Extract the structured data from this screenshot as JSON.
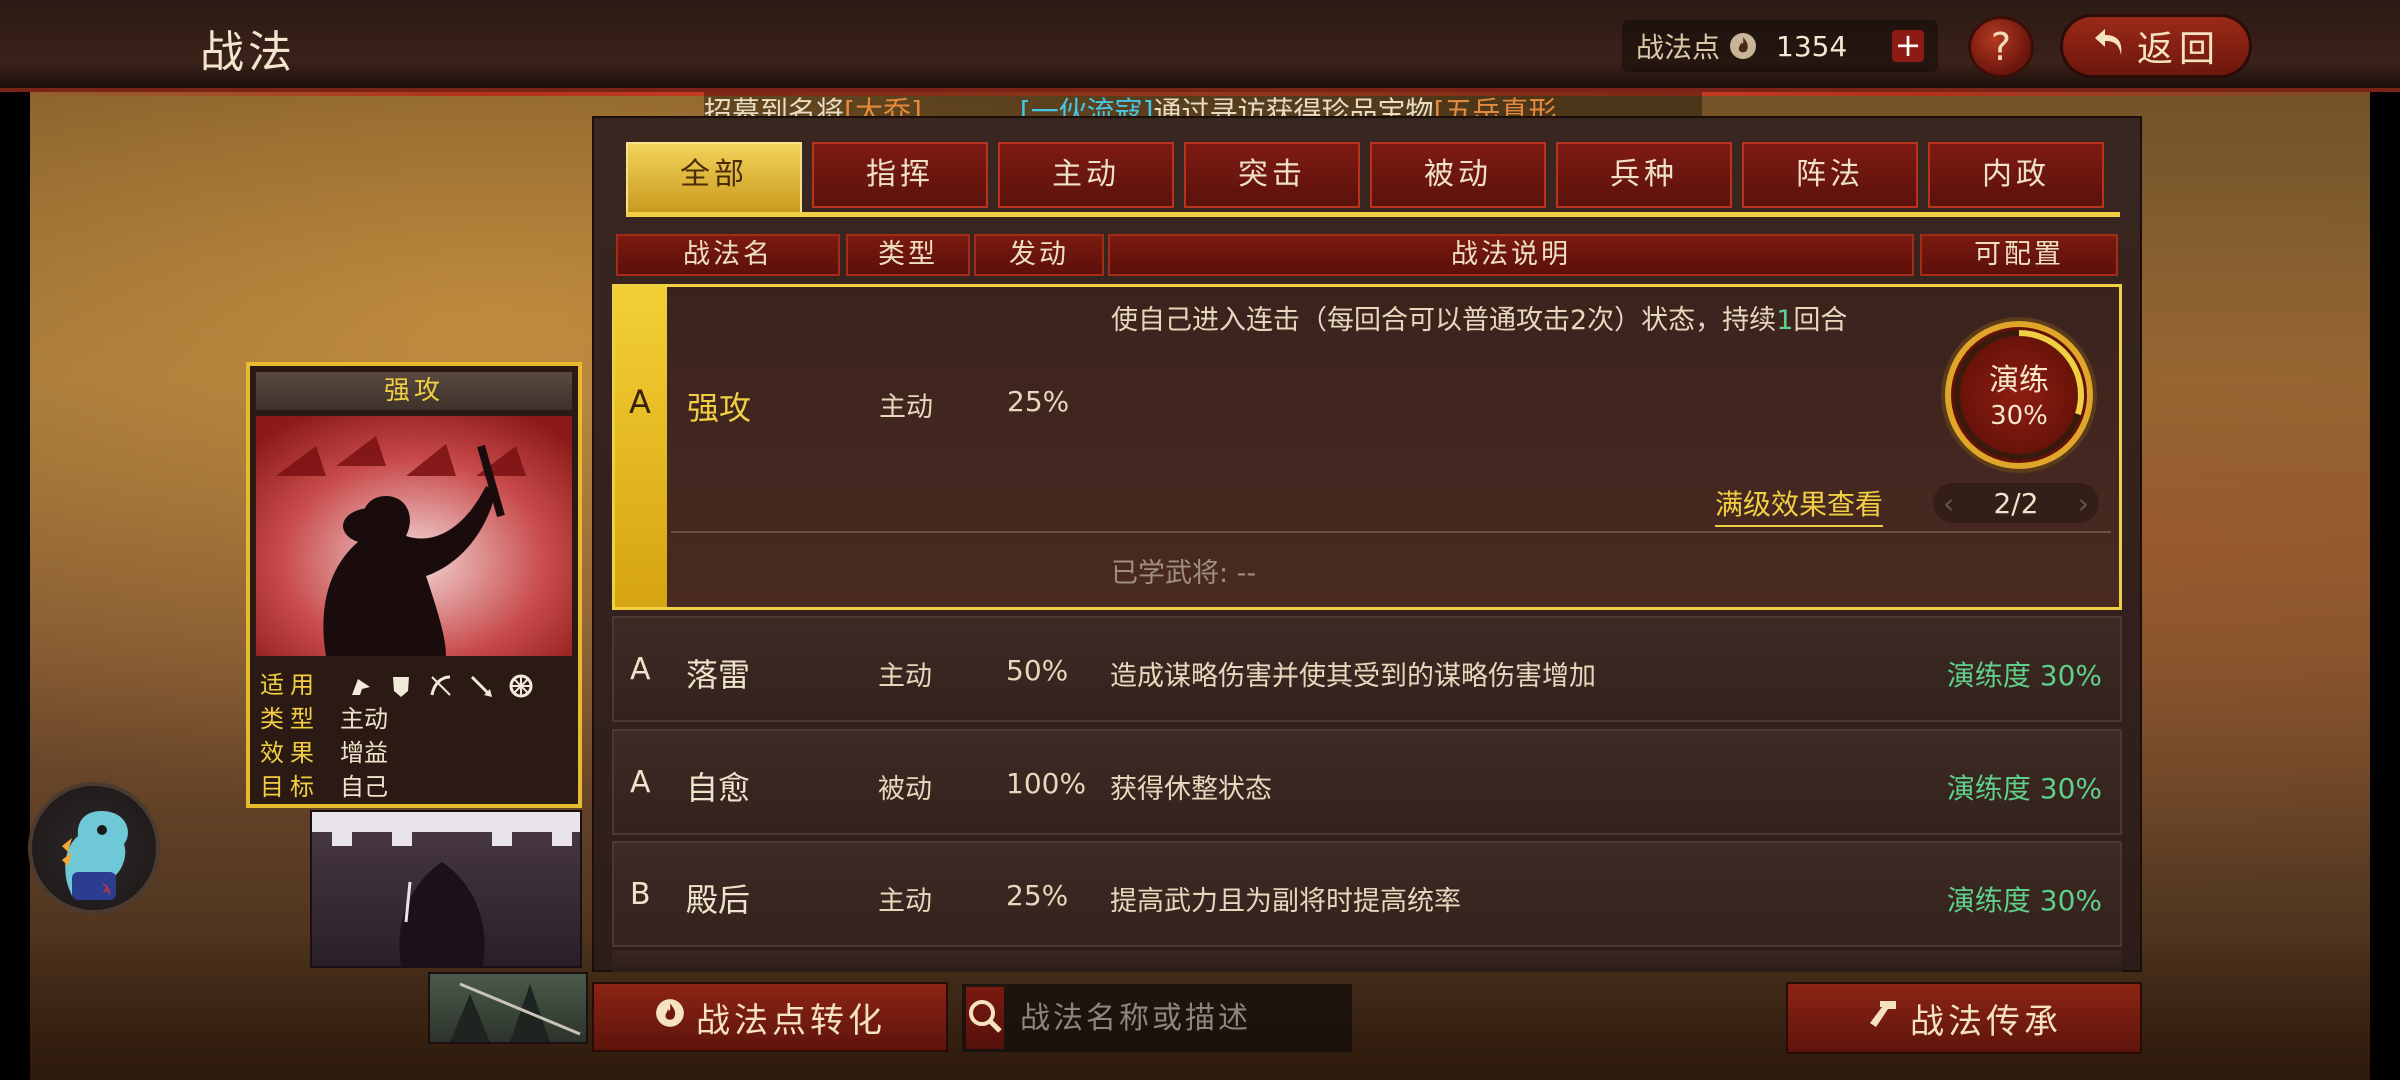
{
  "header": {
    "title": "战法",
    "points_label": "战法点",
    "points_value": "1354",
    "plus_label": "+",
    "help_label": "?",
    "back_label": "返回"
  },
  "ticker": {
    "part1": "招募到名将",
    "part2": "[大乔]",
    "part3": "[一伙流寇]",
    "part4": "通过寻访获得珍品宝物",
    "part5": "[五岳真形"
  },
  "tabs": [
    {
      "label": "全部",
      "active": true
    },
    {
      "label": "指挥",
      "active": false
    },
    {
      "label": "主动",
      "active": false
    },
    {
      "label": "突击",
      "active": false
    },
    {
      "label": "被动",
      "active": false
    },
    {
      "label": "兵种",
      "active": false
    },
    {
      "label": "阵法",
      "active": false
    },
    {
      "label": "内政",
      "active": false
    }
  ],
  "columns": {
    "name": "战法名",
    "type": "类型",
    "rate": "发动",
    "desc": "战法说明",
    "config": "可配置"
  },
  "selected": {
    "grade": "A",
    "name": "强攻",
    "type": "主动",
    "rate": "25%",
    "desc_a": "使自己进入连击（每回合可以普通攻击2次）状态，持续",
    "desc_num": "1",
    "desc_b": "回合",
    "practice_label": "演练",
    "practice_pct": "30%",
    "practice_progress": 0.3,
    "full_effect": "满级效果查看",
    "page": "2/2",
    "learned": "已学武将:  --"
  },
  "rows": [
    {
      "grade": "A",
      "name": "落雷",
      "type": "主动",
      "rate": "50%",
      "desc": "造成谋略伤害并使其受到的谋略伤害增加",
      "prof": "演练度 30%"
    },
    {
      "grade": "A",
      "name": "自愈",
      "type": "被动",
      "rate": "100%",
      "desc": "获得休整状态",
      "prof": "演练度 30%"
    },
    {
      "grade": "B",
      "name": "殿后",
      "type": "主动",
      "rate": "25%",
      "desc": "提高武力且为副将时提高统率",
      "prof": "演练度 30%"
    }
  ],
  "card": {
    "title": "强攻",
    "apply_label": "适用",
    "type_label": "类型",
    "type_value": "主动",
    "effect_label": "效果",
    "effect_value": "增益",
    "target_label": "目标",
    "target_value": "自己"
  },
  "bottom": {
    "convert_label": "战法点转化",
    "search_placeholder": "战法名称或描述",
    "inherit_label": "战法传承"
  },
  "colors": {
    "accent_gold": "#f1cf42",
    "tab_red": "#7e1b12",
    "proficiency_green": "#5fcf8a",
    "ticker_orange": "#e58a3c",
    "ticker_cyan": "#47c6e6"
  },
  "icons": [
    "flame-icon",
    "plus-icon",
    "help-icon",
    "back-arrow-icon",
    "search-icon",
    "hammer-icon",
    "cavalry-icon",
    "shield-icon",
    "bow-icon",
    "spear-icon",
    "wheel-icon"
  ]
}
